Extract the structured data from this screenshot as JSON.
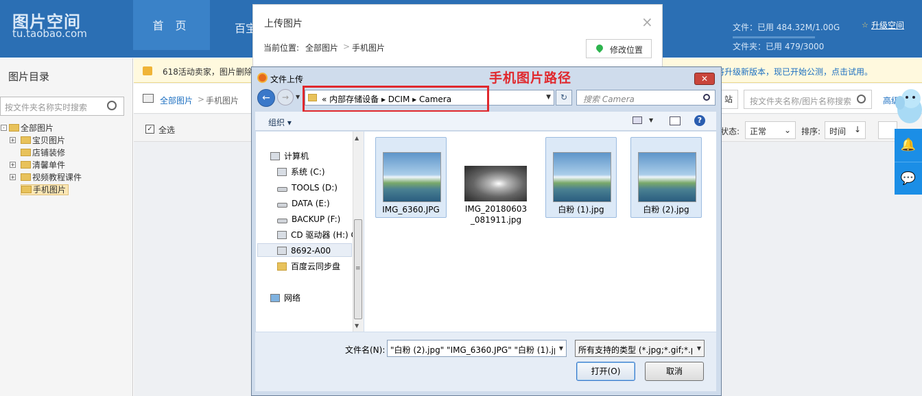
{
  "header": {
    "logo_cn": "图片空间",
    "logo_en": "tu.taobao.com",
    "nav_home": "首 页",
    "nav_second": "百宝",
    "quota_files": "文件：已用 484.32M/1.00G",
    "quota_folders": "文件夹：已用 479/3000",
    "upgrade": "升级空间"
  },
  "sidebar": {
    "title": "图片目录",
    "search_placeholder": "按文件夹名称实时搜索",
    "tree": [
      {
        "label": "全部图片",
        "expand": "-"
      },
      {
        "label": "宝贝图片",
        "expand": "+"
      },
      {
        "label": "店铺装修",
        "expand": ""
      },
      {
        "label": "清馨单件",
        "expand": "+"
      },
      {
        "label": "视频教程课件",
        "expand": "+"
      },
      {
        "label": "手机图片",
        "expand": ""
      }
    ]
  },
  "notice": {
    "text": "618活动卖家，图片删除",
    "right_text": "将升级新版本，现已开始公测，点击试用。"
  },
  "subbar": {
    "crumb_root": "全部图片",
    "crumb_sep": ">",
    "crumb_current": "手机图片",
    "station_btn": "站",
    "search_placeholder": "按文件夹名称/图片名称搜索",
    "advanced": "高级搜索"
  },
  "toolbar": {
    "select_all": "全选",
    "status_label": "状态:",
    "status_value": "正常",
    "sort_label": "排序:",
    "sort_value": "时间"
  },
  "upload_modal": {
    "title": "上传图片",
    "close": "×",
    "location_label": "当前位置:",
    "location_root": "全部图片",
    "location_sep": ">",
    "location_current": "手机图片",
    "change_location": "修改位置"
  },
  "dialog": {
    "title": "文件上传",
    "close": "✕",
    "annotation": "手机图片路径",
    "address_path": "«  内部存储设备  ▸  DCIM  ▸  Camera",
    "search_placeholder": "搜索 Camera",
    "organize": "组织 ▾",
    "nav": [
      {
        "label": "计算机"
      },
      {
        "label": "系统 (C:)"
      },
      {
        "label": "TOOLS (D:)"
      },
      {
        "label": "DATA (E:)"
      },
      {
        "label": "BACKUP (F:)"
      },
      {
        "label": "CD 驱动器 (H:) C"
      },
      {
        "label": "8692-A00"
      },
      {
        "label": "百度云同步盘"
      },
      {
        "label": "网络"
      }
    ],
    "files": [
      {
        "name": "IMG_6360.JPG",
        "selected": true
      },
      {
        "name": "IMG_20180603_081911.jpg",
        "selected": false
      },
      {
        "name": "白粉 (1).jpg",
        "selected": true
      },
      {
        "name": "白粉 (2).jpg",
        "selected": true
      }
    ],
    "filename_label": "文件名(N):",
    "filename_value": "\"白粉 (2).jpg\" \"IMG_6360.JPG\" \"白粉 (1).jpg",
    "filetype_value": "所有支持的类型 (*.jpg;*.gif;*.p",
    "open_btn": "打开(O)",
    "cancel_btn": "取消"
  },
  "colors": {
    "header_bg": "#2b6fb4",
    "annotation_red": "#e0282d",
    "side_blue": "#1b8ee6"
  }
}
